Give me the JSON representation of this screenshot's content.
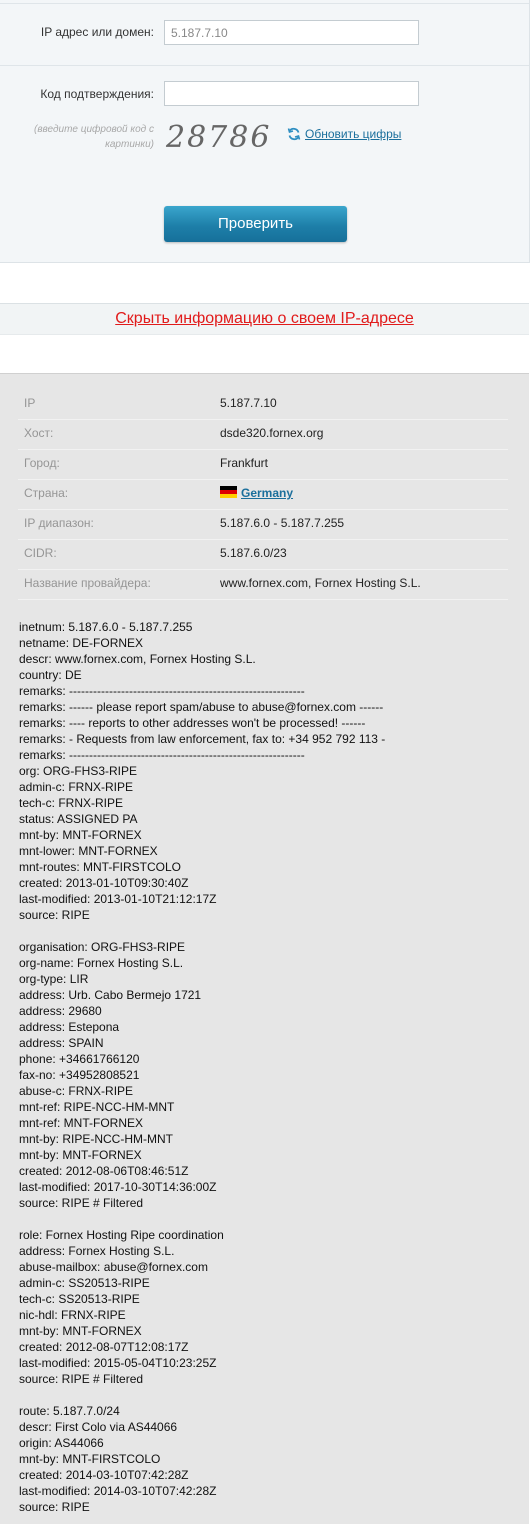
{
  "form": {
    "ip_label": "IP адрес или домен:",
    "ip_value": "5.187.7.10",
    "code_label": "Код подтверждения:",
    "code_value": "",
    "hint": "(введите цифровой код с картинки)",
    "captcha": "28786",
    "refresh_label": "Обновить цифры",
    "submit_label": "Проверить"
  },
  "hide_link": "Скрыть информацию о своем IP-адресе",
  "info": {
    "rows": [
      {
        "key": "IP",
        "value": "5.187.7.10"
      },
      {
        "key": "Хост:",
        "value": "dsde320.fornex.org"
      },
      {
        "key": "Город:",
        "value": "Frankfurt"
      },
      {
        "key": "Страна:",
        "value": "Germany",
        "icon": "germany-flag-icon"
      },
      {
        "key": "IP диапазон:",
        "value": "5.187.6.0 - 5.187.7.255"
      },
      {
        "key": "CIDR:",
        "value": "5.187.6.0/23"
      },
      {
        "key": "Название провайдера:",
        "value": "www.fornex.com, Fornex Hosting S.L."
      }
    ]
  },
  "whois": "inetnum: 5.187.6.0 - 5.187.7.255\nnetname: DE-FORNEX\ndescr: www.fornex.com, Fornex Hosting S.L.\ncountry: DE\nremarks: -----------------------------------------------------------\nremarks: ------ please report spam/abuse to abuse@fornex.com ------\nremarks: ---- reports to other addresses won't be processed! ------\nremarks: - Requests from law enforcement, fax to: +34 952 792 113 -\nremarks: -----------------------------------------------------------\norg: ORG-FHS3-RIPE\nadmin-c: FRNX-RIPE\ntech-c: FRNX-RIPE\nstatus: ASSIGNED PA\nmnt-by: MNT-FORNEX\nmnt-lower: MNT-FORNEX\nmnt-routes: MNT-FIRSTCOLO\ncreated: 2013-01-10T09:30:40Z\nlast-modified: 2013-01-10T21:12:17Z\nsource: RIPE\n\norganisation: ORG-FHS3-RIPE\norg-name: Fornex Hosting S.L.\norg-type: LIR\naddress: Urb. Cabo Bermejo 1721\naddress: 29680\naddress: Estepona\naddress: SPAIN\nphone: +34661766120\nfax-no: +34952808521\nabuse-c: FRNX-RIPE\nmnt-ref: RIPE-NCC-HM-MNT\nmnt-ref: MNT-FORNEX\nmnt-by: RIPE-NCC-HM-MNT\nmnt-by: MNT-FORNEX\ncreated: 2012-08-06T08:46:51Z\nlast-modified: 2017-10-30T14:36:00Z\nsource: RIPE # Filtered\n\nrole: Fornex Hosting Ripe coordination\naddress: Fornex Hosting S.L.\nabuse-mailbox: abuse@fornex.com\nadmin-c: SS20513-RIPE\ntech-c: SS20513-RIPE\nnic-hdl: FRNX-RIPE\nmnt-by: MNT-FORNEX\ncreated: 2012-08-07T12:08:17Z\nlast-modified: 2015-05-04T10:23:25Z\nsource: RIPE # Filtered\n\nroute: 5.187.7.0/24\ndescr: First Colo via AS44066\norigin: AS44066\nmnt-by: MNT-FIRSTCOLO\ncreated: 2014-03-10T07:42:28Z\nlast-modified: 2014-03-10T07:42:28Z\nsource: RIPE",
  "colors": {
    "accent": "#1e7fa9",
    "link": "#1b6f9c",
    "alert": "#e11b1b",
    "panel": "#e6e6e6"
  }
}
